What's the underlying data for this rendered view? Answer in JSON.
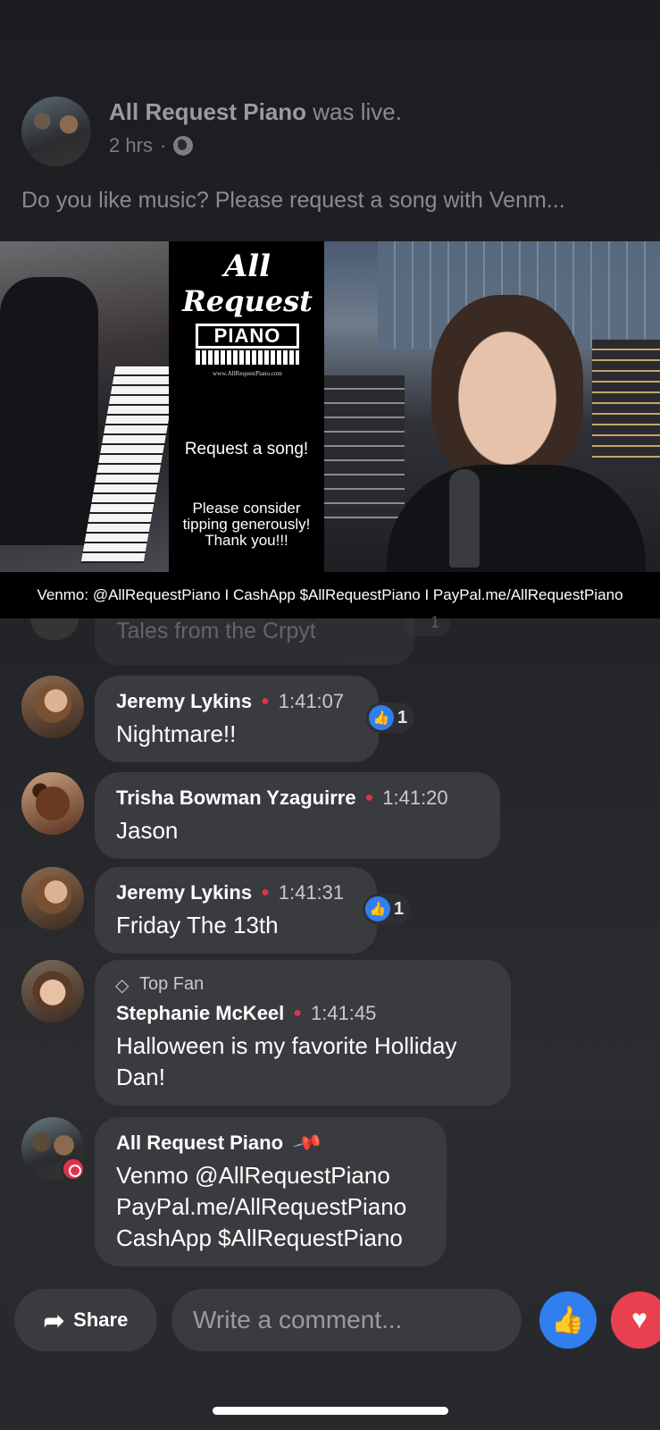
{
  "post": {
    "page_name": "All Request Piano",
    "status": "was live.",
    "time_ago": "2 hrs",
    "separator": "·",
    "text": "Do you like music? Please request a song with Venm..."
  },
  "video": {
    "logo_line1": "All",
    "logo_line2": "Request",
    "logo_piano": "PIANO",
    "logo_site": "www.AllRequestPiano.com",
    "request_text": "Request a song!",
    "tip_line1": "Please consider",
    "tip_line2": "tipping generously!",
    "tip_line3": "Thank you!!!",
    "payment_bar": "Venmo: @AllRequestPiano   I   CashApp $AllRequestPiano   I   PayPal.me/AllRequestPiano"
  },
  "faded_comment": {
    "text": "Tales from the Crpyt",
    "like_count": "1"
  },
  "comments": [
    {
      "author": "Jeremy Lykins",
      "time": "1:41:07",
      "text": "Nightmare!!",
      "likes": "1"
    },
    {
      "author": "Trisha Bowman Yzaguirre",
      "time": "1:41:20",
      "text": "Jason"
    },
    {
      "author": "Jeremy Lykins",
      "time": "1:41:31",
      "text": "Friday The 13th",
      "likes": "1"
    },
    {
      "badge": "Top Fan",
      "author": "Stephanie McKeel",
      "time": "1:41:45",
      "text": "Halloween is my favorite Holliday\nDan!"
    },
    {
      "author": "All Request Piano",
      "text": "Venmo @AllRequestPiano\nPayPal.me/AllRequestPiano\nCashApp $AllRequestPiano"
    }
  ],
  "bottom_bar": {
    "share_label": "Share",
    "comment_placeholder": "Write a comment..."
  },
  "icons": {
    "like": "thumbs-up-icon",
    "love": "heart-icon",
    "share": "share-arrow-icon",
    "globe": "globe-icon",
    "pin": "pin-icon",
    "top_fan": "diamond-icon"
  },
  "colors": {
    "like_blue": "#2f7ff0",
    "love_red": "#e8404f",
    "live_red": "#e0324a",
    "bubble": "#3a3b3f"
  }
}
